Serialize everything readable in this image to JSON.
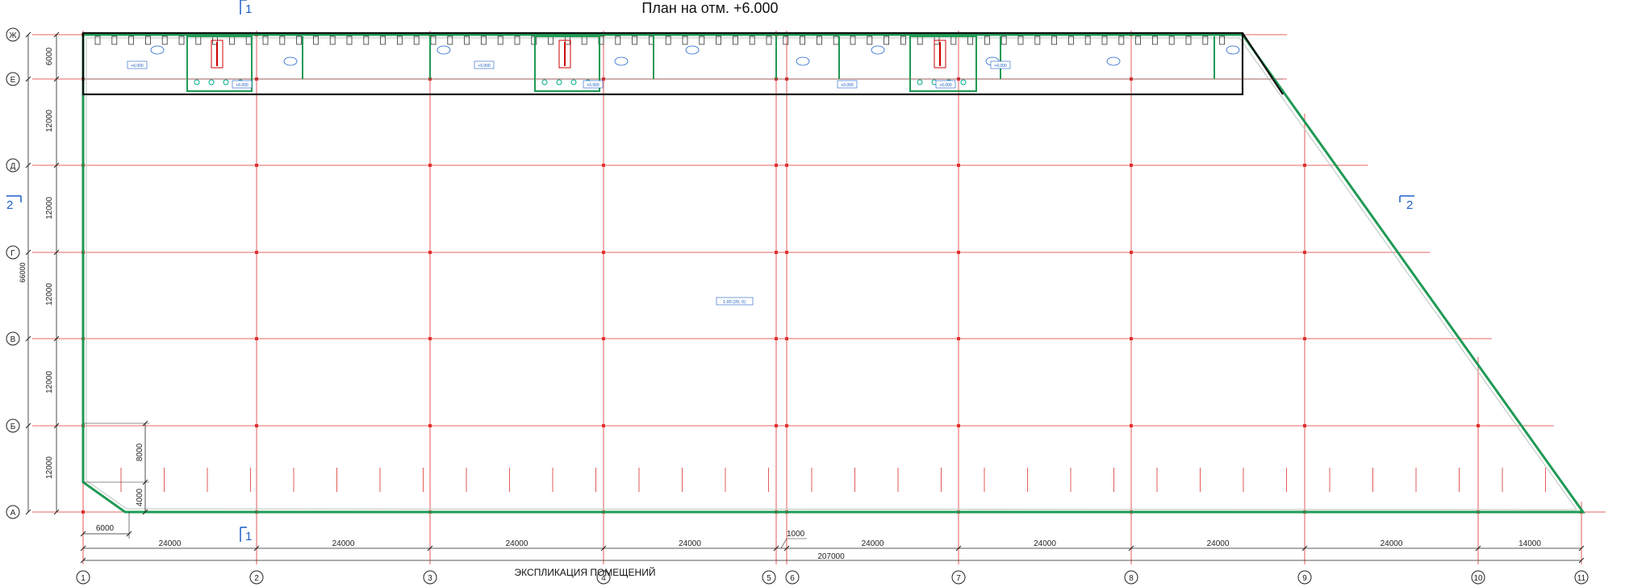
{
  "title": "План на отм. +6.000",
  "caption": "ЭКСПЛИКАЦИЯ ПОМЕЩЕНИЙ",
  "colors": {
    "grid": "#e03030",
    "wall": "#1f9a55",
    "outline": "#111111",
    "tag": "#1d5fc7"
  },
  "rows": [
    {
      "label": "Ж"
    },
    {
      "label": "Е"
    },
    {
      "label": "Д"
    },
    {
      "label": "Г"
    },
    {
      "label": "В"
    },
    {
      "label": "Б"
    },
    {
      "label": "А"
    }
  ],
  "columns": [
    {
      "label": "1"
    },
    {
      "label": "2"
    },
    {
      "label": "3"
    },
    {
      "label": "4"
    },
    {
      "label": "5"
    },
    {
      "label": "6"
    },
    {
      "label": "7"
    },
    {
      "label": "8"
    },
    {
      "label": "9"
    },
    {
      "label": "10"
    },
    {
      "label": "11"
    }
  ],
  "vertical_dims": [
    "6000",
    "12000",
    "12000",
    "12000",
    "12000",
    "12000"
  ],
  "vertical_total": "66000",
  "corner_dims": [
    "8000",
    "4000"
  ],
  "bottom_corner_dim": "6000",
  "horizontal_dims": [
    "24000",
    "24000",
    "24000",
    "24000",
    "24000",
    "24000",
    "24000",
    "24000",
    "14000"
  ],
  "small_dim": "1000",
  "horizontal_total": "207000",
  "section_marks": [
    {
      "label": "1"
    },
    {
      "label": "1"
    },
    {
      "label": "2"
    },
    {
      "label": "2"
    }
  ],
  "floor_tag": "1.00 (20, 0)",
  "level_tags": [
    "+6.000",
    "+6.000",
    "+6.000",
    "+6.000",
    "+6.000",
    "+6.000",
    "+6.000"
  ]
}
